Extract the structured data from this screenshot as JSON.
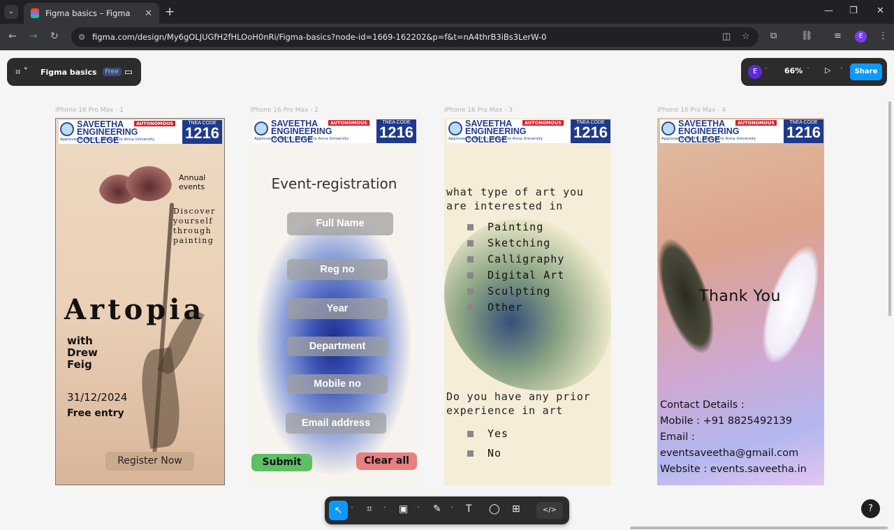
{
  "browser": {
    "tab_title": "Figma basics – Figma",
    "url": "figma.com/design/My6gOLJUGfH2fHLOoH0nRi/Figma-basics?node-id=1669-162202&p=f&t=nA4thrB3iBs3LerW-0",
    "profile_initial": "E"
  },
  "figma": {
    "file_name": "Figma basics",
    "plan_badge": "Free",
    "user_initial": "E",
    "zoom": "66%",
    "share_label": "Share"
  },
  "college": {
    "autonomous": "AUTONOMOUS",
    "name1": "SAVEETHA",
    "name2": "ENGINEERING COLLEGE",
    "approval": "Approved by AICTE | Affiliated to Anna University",
    "tnea_label": "TNEA CODE",
    "tnea_code": "1216"
  },
  "frames": {
    "f1": {
      "label": "iPhone 16 Pro Max - 1",
      "annual": "Annual events",
      "discover": "Discover yourself through painting",
      "title": "Artopia",
      "with": "with Drew Feig",
      "date": "31/12/2024",
      "free": "Free entry",
      "register": "Register Now"
    },
    "f2": {
      "label": "iPhone 16 Pro Max - 2",
      "title": "Event-registration",
      "fields": [
        "Full Name",
        "Reg no",
        "Year",
        "Department",
        "Mobile no",
        "Email address"
      ],
      "submit": "Submit",
      "clear": "Clear all"
    },
    "f3": {
      "label": "iPhone 16 Pro Max - 3",
      "q1": "what type of art you are interested in",
      "options1": [
        "Painting",
        "Sketching",
        "Calligraphy",
        "Digital Art",
        "Sculpting",
        "Other"
      ],
      "q2": "Do you have any prior experience in art",
      "options2": [
        "Yes",
        "No"
      ]
    },
    "f4": {
      "label": "iPhone 16 Pro Max - 4",
      "thanks": "Thank You",
      "contact": [
        "Contact Details :",
        "Mobile : +91 8825492139",
        "Email :",
        "eventsaveetha@gmail.com",
        "Website : events.saveetha.in"
      ]
    }
  },
  "toolbar": {
    "tools": [
      "move-tool",
      "frame-tool",
      "image-tool",
      "pen-tool",
      "text-tool",
      "comment-tool",
      "actions-tool",
      "dev-mode-toggle"
    ]
  },
  "help_label": "?"
}
